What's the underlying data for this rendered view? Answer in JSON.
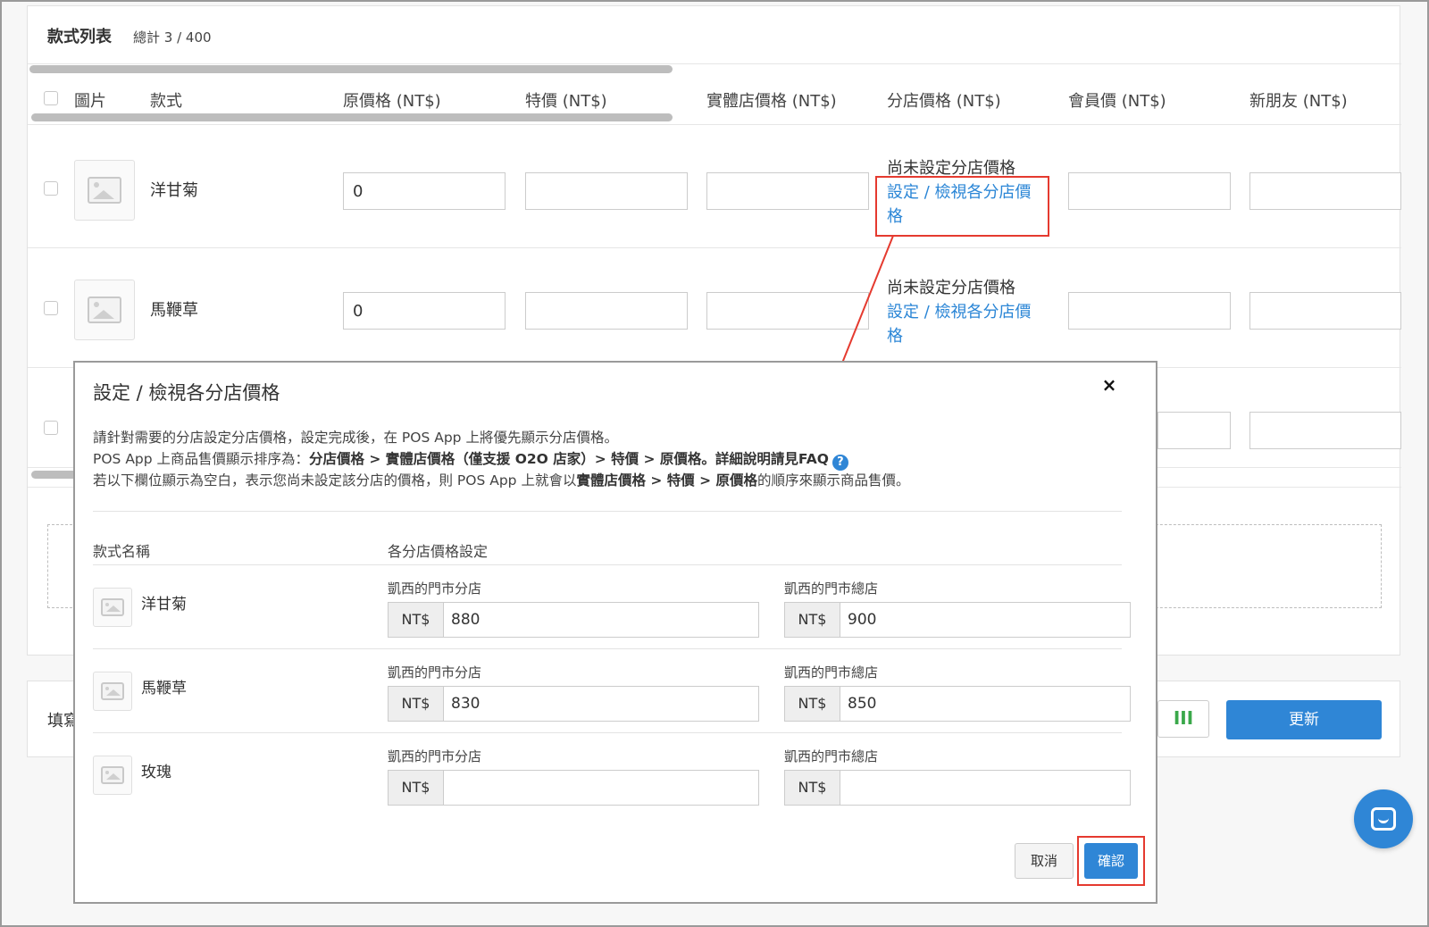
{
  "list": {
    "title": "款式列表",
    "count": "總計 3 / 400",
    "columns": [
      "圖片",
      "款式",
      "原價格 (NT$)",
      "特價 (NT$)",
      "實體店價格 (NT$)",
      "分店價格 (NT$)",
      "會員價 (NT$)",
      "新朋友 (NT$)"
    ],
    "rows": [
      {
        "name": "洋甘菊",
        "original_price": "0",
        "branch_note": "尚未設定分店價格",
        "branch_link_1": "設定 / 檢視各分店價",
        "branch_link_2": "格"
      },
      {
        "name": "馬鞭草",
        "original_price": "0",
        "branch_note": "尚未設定分店價格",
        "branch_link_1": "設定 / 檢視各分店價",
        "branch_link_2": "格"
      }
    ]
  },
  "bottom": {
    "fill_label": "填寫",
    "update_label": "更新",
    "green_glyph": "III"
  },
  "modal": {
    "title": "設定 / 檢視各分店價格",
    "close": "×",
    "desc1": "請針對需要的分店設定分店價格，設定完成後，在 POS App 上將優先顯示分店價格。",
    "desc2_pre": "POS App 上商品售價顯示排序為：",
    "desc2_bold": "分店價格 > 實體店價格（僅支援 O2O 店家）> 特價 > 原價格。詳細說明請見FAQ",
    "desc3_pre": "若以下欄位顯示為空白，表示您尚未設定該分店的價格，則 POS App 上就會以",
    "desc3_bold": "實體店價格 > 特價 > 原價格",
    "desc3_post": "的順序來顯示商品售價。",
    "faq_icon": "?",
    "head_name": "款式名稱",
    "head_price": "各分店價格設定",
    "currency": "NT$",
    "items": [
      {
        "name": "洋甘菊",
        "store1": "凱西的門市分店",
        "price1": "880",
        "store2": "凱西的門市總店",
        "price2": "900"
      },
      {
        "name": "馬鞭草",
        "store1": "凱西的門市分店",
        "price1": "830",
        "store2": "凱西的門市總店",
        "price2": "850"
      },
      {
        "name": "玫瑰",
        "store1": "凱西的門市分店",
        "price1": "",
        "store2": "凱西的門市總店",
        "price2": ""
      }
    ],
    "cancel": "取消",
    "confirm": "確認"
  },
  "colors": {
    "accent": "#2f86d6",
    "highlight": "#e53a2f"
  }
}
